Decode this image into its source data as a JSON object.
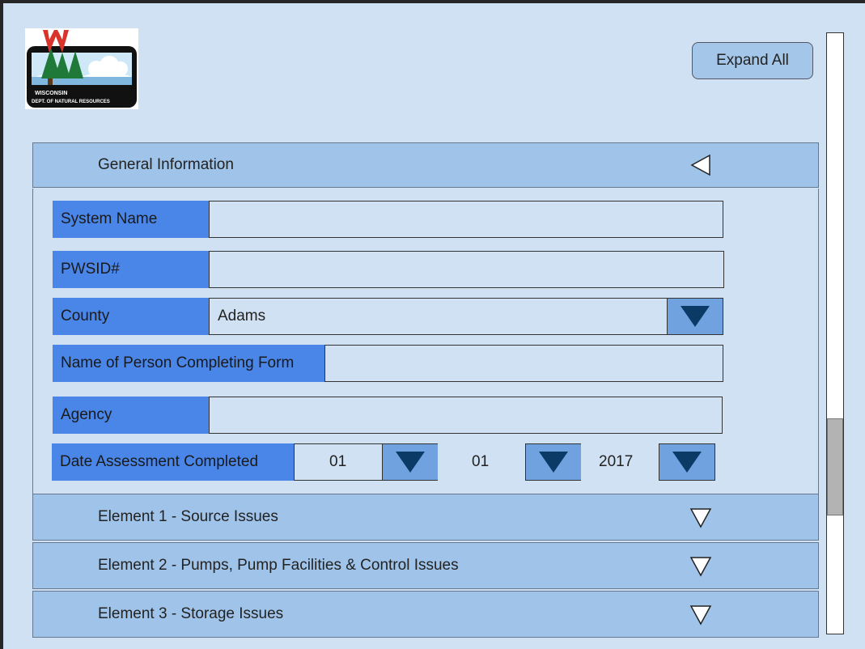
{
  "logo": {
    "line1": "WISCONSIN",
    "line2": "DEPT. OF NATURAL RESOURCES"
  },
  "toolbar": {
    "expand_all": "Expand All"
  },
  "general": {
    "title": "General Information",
    "fields": {
      "system_name": {
        "label": "System Name",
        "value": ""
      },
      "pwsid": {
        "label": "PWSID#",
        "value": ""
      },
      "county": {
        "label": "County",
        "value": "Adams"
      },
      "person": {
        "label": "Name of Person Completing Form",
        "value": ""
      },
      "agency": {
        "label": "Agency",
        "value": ""
      },
      "date": {
        "label": "Date Assessment Completed",
        "month": "01",
        "day": "01",
        "year": "2017"
      }
    }
  },
  "sections": [
    {
      "title": "Element 1 - Source Issues"
    },
    {
      "title": "Element 2 - Pumps, Pump Facilities & Control Issues"
    },
    {
      "title": "Element 3 - Storage Issues"
    }
  ],
  "colors": {
    "background": "#cfe1f2",
    "header": "#a0c4e9",
    "label": "#4a86e8",
    "dropdown": "#6fa2de",
    "arrow": "#0b3a66"
  }
}
